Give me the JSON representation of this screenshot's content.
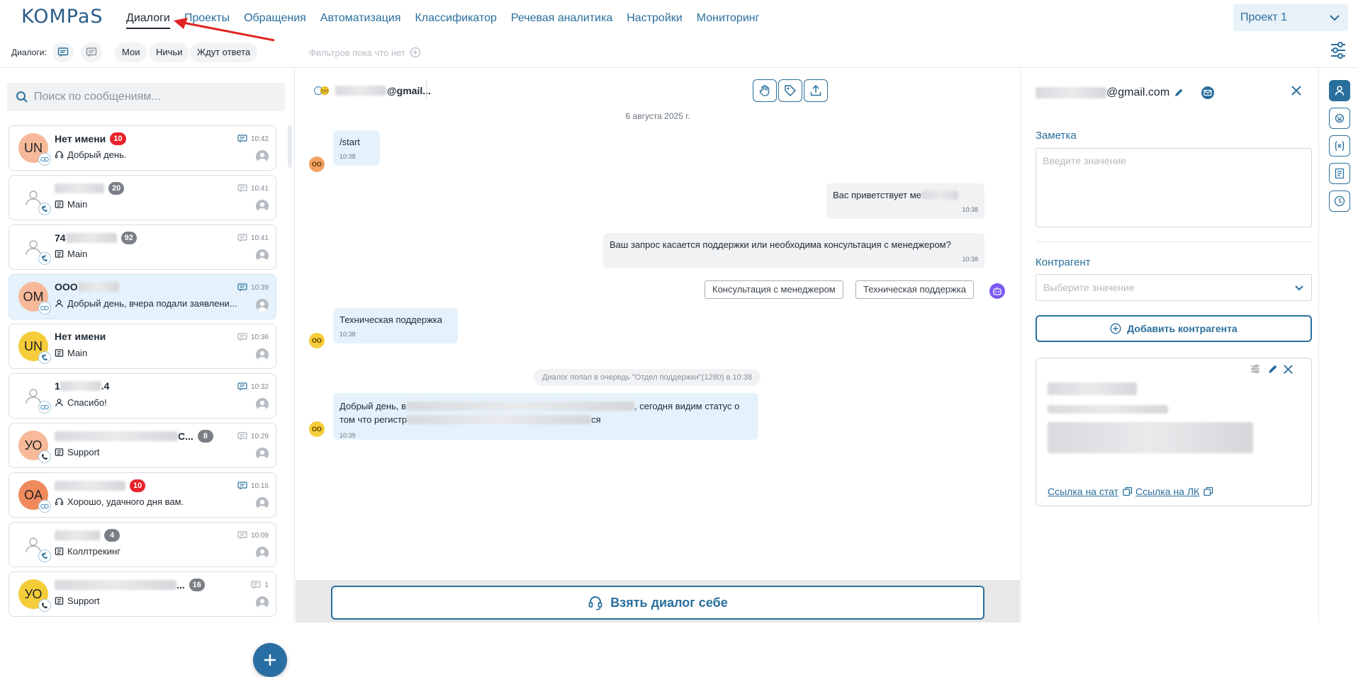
{
  "app": {
    "logo_text": "KOMPaS",
    "nav": [
      {
        "label": "Диалоги",
        "active": true
      },
      {
        "label": "Проекты"
      },
      {
        "label": "Обращения"
      },
      {
        "label": "Автоматизация"
      },
      {
        "label": "Классификатор"
      },
      {
        "label": "Речевая аналитика"
      },
      {
        "label": "Настройки"
      },
      {
        "label": "Мониторинг"
      }
    ],
    "project": "Проект 1"
  },
  "filters": {
    "label": "Диалоги:",
    "chips": [
      "Мои",
      "Ничьи",
      "Ждут ответа"
    ],
    "empty_text": "Фильтров пока что нет"
  },
  "search": {
    "placeholder": "Поиск по сообщениям..."
  },
  "dialogs": [
    {
      "initials": "UN",
      "avatar_color": "#f7b99a",
      "name": "Нет имени",
      "count": "10",
      "count_color": "red",
      "sub": "Добрый день.",
      "sub_icon": "headset-icon",
      "time": "10:42",
      "unread": true,
      "channel": "chat"
    },
    {
      "initials": "",
      "avatar_color": "#ffffff",
      "name": "",
      "count": "20",
      "count_color": "gray",
      "sub": "Main",
      "sub_icon": "queue-icon",
      "time": "10:41",
      "unread": false,
      "channel": "call"
    },
    {
      "initials": "",
      "avatar_color": "#ffffff",
      "name": "74",
      "count": "92",
      "count_color": "gray",
      "sub": "Main",
      "sub_icon": "queue-icon",
      "time": "10:41",
      "unread": false,
      "channel": "call"
    },
    {
      "initials": "OM",
      "avatar_color": "#f7b99a",
      "name": "ООО",
      "count": "",
      "count_color": "",
      "sub": "Добрый день, вчера подали заявлени...",
      "sub_icon": "user-icon",
      "time": "10:39",
      "unread": true,
      "channel": "chat",
      "selected": true
    },
    {
      "initials": "UN",
      "avatar_color": "#f5cd3a",
      "name": "Нет имени",
      "count": "",
      "count_color": "",
      "sub": "Main",
      "sub_icon": "queue-icon",
      "time": "10:36",
      "unread": false,
      "channel": "call"
    },
    {
      "initials": "",
      "avatar_color": "#ffffff",
      "name": "1",
      "name_suffix": ".4",
      "count": "",
      "count_color": "",
      "sub": "Спасибо!",
      "sub_icon": "user-icon",
      "time": "10:32",
      "unread": true,
      "channel": "chat"
    },
    {
      "initials": "УО",
      "avatar_color": "#f7b99a",
      "name": "",
      "name_suffix": "С...",
      "count": "8",
      "count_color": "gray",
      "sub": "Support",
      "sub_icon": "queue-icon",
      "time": "10:29",
      "unread": false,
      "channel": "phone"
    },
    {
      "initials": "OA",
      "avatar_color": "#f08a5d",
      "name": "",
      "count": "10",
      "count_color": "red",
      "sub": "Хорошо, удачного дня вам.",
      "sub_icon": "headset-icon",
      "time": "10:16",
      "unread": true,
      "channel": "chat"
    },
    {
      "initials": "",
      "avatar_color": "#ffffff",
      "name": "",
      "count": "4",
      "count_color": "gray",
      "sub": "Коллтрекинг",
      "sub_icon": "queue-icon",
      "time": "10:09",
      "unread": false,
      "channel": "call"
    },
    {
      "initials": "УО",
      "avatar_color": "#f5cd3a",
      "name": "",
      "name_suffix": "...",
      "count": "16",
      "count_color": "gray",
      "sub": "Support",
      "sub_icon": "queue-icon",
      "time": "1",
      "unread": false,
      "channel": "phone"
    }
  ],
  "chat": {
    "contact_email": "@gmail...",
    "date": "6 августа 2025 г.",
    "messages": [
      {
        "dir": "in",
        "text": "/start",
        "time": "10:38"
      },
      {
        "dir": "out",
        "text": "Вас приветствует ме",
        "time": "10:38"
      },
      {
        "dir": "out",
        "text": "Ваш запрос касается поддержки или необходима консультация с менеджером?",
        "time": "10:38"
      },
      {
        "dir": "in",
        "text": "Техническая поддержка",
        "time": "10:38"
      },
      {
        "dir": "in",
        "text_1": "Добрый день, в",
        "text_2": ", сегодня видим статус о",
        "text_3": "том что регистр",
        "text_4": "ся",
        "time": "10:39"
      }
    ],
    "quick_replies": [
      "Консультация с менеджером",
      "Техническая поддержка"
    ],
    "system": "Диалог попал в очередь \"Отдел поддержки\"(1280) в 10:38",
    "avatar_label": "OO",
    "take_button": "Взять диалог себе"
  },
  "panel": {
    "email": "@gmail.com",
    "note_label": "Заметка",
    "note_placeholder": "Введите значение",
    "cp_label": "Контрагент",
    "cp_placeholder": "Выберите значение",
    "add_cp": "Добавить контрагента",
    "card_link_1": "Ссылка на стат",
    "card_link_2": "Ссылка на ЛК"
  },
  "colors": {
    "accent": "#2a6f9c",
    "selected_row": "#e6f2fb",
    "badge_red": "#e8232b",
    "badge_gray": "#7a7f85",
    "bot": "#7a5af0"
  }
}
